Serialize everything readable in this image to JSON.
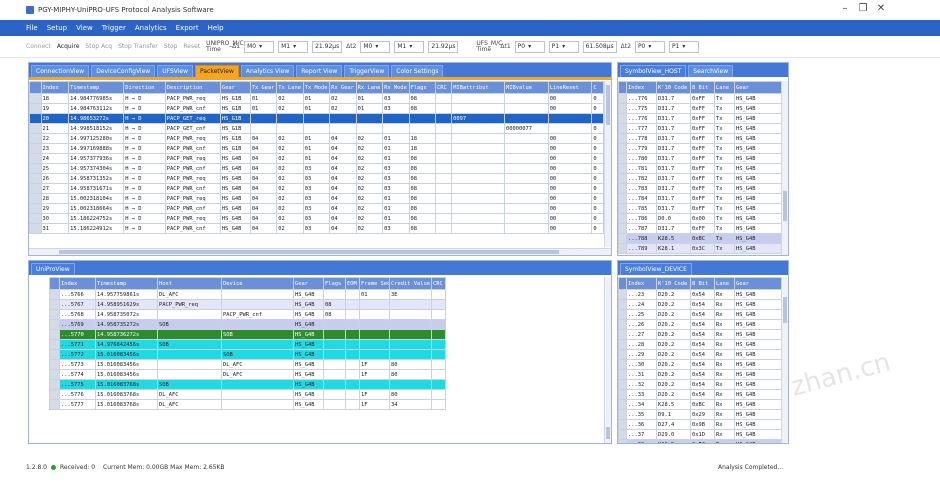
{
  "window": {
    "title": "PGY-MIPHY-UniPRO-UFS Protocol Analysis Software",
    "controls": [
      "–",
      "❐",
      "✕"
    ]
  },
  "menu": [
    "File",
    "Setup",
    "View",
    "Trigger",
    "Analytics",
    "Export",
    "Help"
  ],
  "toolbar": {
    "buttons": [
      "Connect",
      "Acquire",
      "Stop Acq",
      "Stop Transfer",
      "Stop",
      "Reset"
    ],
    "left_group": {
      "label": "UNIPRO_M/C Time",
      "delta": "Δ1",
      "m1": "M0",
      "m2": "M1",
      "time": "21.92μs",
      "delta2": "Δt2",
      "m3": "M0",
      "m4": "M1",
      "time2": "21.92μs"
    },
    "right_group": {
      "label": "UFS_M/C Time",
      "delta": "Δt1",
      "m1": "P0",
      "m2": "P1",
      "time": "61.508μs",
      "delta2": "Δt2",
      "m3": "P0",
      "m4": "P1"
    }
  },
  "top_tabs": [
    "ConnectionView",
    "DeviceConfigView",
    "UFSView",
    "PacketView",
    "Analytics View",
    "Report View",
    "TriggerView",
    "Color Settings"
  ],
  "packet_table": {
    "headers": [
      "Index",
      "Timestamp",
      "Direction",
      "Description",
      "Gear",
      "Tx Gear",
      "Tx Lane",
      "Tx Mode",
      "Rx Gear",
      "Rx Lane",
      "Rx Mode",
      "Flags",
      "CRC",
      "MIBattribut",
      "MIBvalue",
      "LineReset",
      "C"
    ],
    "rows": [
      [
        "18",
        "14.984776985s",
        "H → D",
        "PACP_PWR_req",
        "HS_G1B",
        "01",
        "02",
        "01",
        "02",
        "01",
        "03",
        "08",
        "",
        "",
        "",
        "00",
        "0"
      ],
      [
        "19",
        "14.984763112s",
        "H → D",
        "PACP_PWR_cnf",
        "HS_G1B",
        "01",
        "02",
        "01",
        "02",
        "01",
        "03",
        "08",
        "",
        "",
        "",
        "00",
        "0"
      ],
      [
        "20",
        "14.98653272s",
        "H → D",
        "PACP_GET_req",
        "HS_G1B",
        "",
        "",
        "",
        "",
        "",
        "",
        "",
        "",
        "0097",
        "",
        "",
        ""
      ],
      [
        "21",
        "14.998518152s",
        "H → D",
        "PACP_GET_cnf",
        "HS_G1B",
        "",
        "",
        "",
        "",
        "",
        "",
        "",
        "",
        "",
        "00000077",
        "",
        "0"
      ],
      [
        "22",
        "14.997125280s",
        "H → D",
        "PACP_PWR_req",
        "HS_G1B",
        "04",
        "02",
        "01",
        "04",
        "02",
        "01",
        "18",
        "",
        "",
        "",
        "00",
        "0"
      ],
      [
        "23",
        "14.997169888s",
        "H → D",
        "PACP_PWR_cnf",
        "HS_G1B",
        "04",
        "02",
        "01",
        "04",
        "02",
        "01",
        "18",
        "",
        "",
        "",
        "00",
        "0"
      ],
      [
        "24",
        "14.957377936s",
        "H → D",
        "PACP_PWR_req",
        "HS_G4B",
        "04",
        "02",
        "01",
        "04",
        "02",
        "01",
        "08",
        "",
        "",
        "",
        "00",
        "0"
      ],
      [
        "25",
        "14.957374304s",
        "H → D",
        "PACP_PWR_cnf",
        "HS_G4B",
        "04",
        "02",
        "03",
        "04",
        "02",
        "03",
        "08",
        "",
        "",
        "",
        "00",
        "0"
      ],
      [
        "26",
        "14.958731352s",
        "H → D",
        "PACP_PWR_req",
        "HS_G4B",
        "04",
        "02",
        "03",
        "04",
        "02",
        "03",
        "08",
        "",
        "",
        "",
        "00",
        "0"
      ],
      [
        "27",
        "14.958731671s",
        "H → D",
        "PACP_PWR_cnf",
        "HS_G4B",
        "04",
        "02",
        "03",
        "04",
        "02",
        "03",
        "08",
        "",
        "",
        "",
        "00",
        "0"
      ],
      [
        "28",
        "15.002318104s",
        "H → D",
        "PACP_PWR_req",
        "HS_G4B",
        "04",
        "02",
        "03",
        "04",
        "02",
        "01",
        "08",
        "",
        "",
        "",
        "00",
        "0"
      ],
      [
        "29",
        "15.002318664s",
        "H → D",
        "PACP_PWR_cnf",
        "HS_G4B",
        "04",
        "02",
        "03",
        "04",
        "02",
        "01",
        "08",
        "",
        "",
        "",
        "00",
        "0"
      ],
      [
        "30",
        "15.186224752s",
        "H → D",
        "PACP_PWR_req",
        "HS_G4B",
        "04",
        "02",
        "03",
        "04",
        "02",
        "01",
        "08",
        "",
        "",
        "",
        "00",
        "0"
      ],
      [
        "31",
        "15.186224912s",
        "H → D",
        "PACP_PWR_cnf",
        "HS_G4B",
        "04",
        "02",
        "03",
        "04",
        "02",
        "03",
        "08",
        "",
        "",
        "",
        "00",
        "0"
      ]
    ]
  },
  "symbol_host": {
    "tabs": [
      "SymbolView_HOST",
      "SearchView"
    ],
    "headers": [
      "Index",
      "K'10 Code",
      "8 Bit",
      "Lane",
      "Gear"
    ],
    "rows": [
      [
        "...776",
        "D31.7",
        "0xFF",
        "Tx",
        "HS_G4B"
      ],
      [
        "...775",
        "D31.7",
        "0xFF",
        "Tx",
        "HS_G4B"
      ],
      [
        "...776",
        "D31.7",
        "0xFF",
        "Tx",
        "HS_G4B"
      ],
      [
        "...777",
        "D31.7",
        "0xFF",
        "Tx",
        "HS_G4B"
      ],
      [
        "...778",
        "D31.7",
        "0xFF",
        "Tx",
        "HS_G4B"
      ],
      [
        "...779",
        "D31.7",
        "0xFF",
        "Tx",
        "HS_G4B"
      ],
      [
        "...780",
        "D31.7",
        "0xFF",
        "Tx",
        "HS_G4B"
      ],
      [
        "...781",
        "D31.7",
        "0xFF",
        "Tx",
        "HS_G4B"
      ],
      [
        "...782",
        "D31.7",
        "0xFF",
        "Tx",
        "HS_G4B"
      ],
      [
        "...783",
        "D31.7",
        "0xFF",
        "Tx",
        "HS_G4B"
      ],
      [
        "...784",
        "D31.7",
        "0xFF",
        "Tx",
        "HS_G4B"
      ],
      [
        "...785",
        "D31.7",
        "0xFF",
        "Tx",
        "HS_G4B"
      ],
      [
        "...786",
        "D0.0",
        "0x00",
        "Tx",
        "HS_G4B"
      ],
      [
        "...787",
        "D31.7",
        "0xFF",
        "Tx",
        "HS_G4B"
      ],
      [
        "...788",
        "K28.5",
        "0xBC",
        "Tx",
        "HS_G4B"
      ],
      [
        "...789",
        "K28.1",
        "0x3C",
        "Tx",
        "HS_G4B"
      ]
    ]
  },
  "unipro": {
    "tab": "UniProView",
    "headers": [
      "Index",
      "Timestamp",
      "Host",
      "Device",
      "Gear",
      "Flags",
      "EOM",
      "Frame Seq",
      "Credit Value",
      "CRC"
    ],
    "rows": [
      [
        "...5766",
        "14.957759861s",
        "DL_AFC",
        "",
        "HS_G4B",
        "",
        "",
        "01",
        "3E",
        ""
      ],
      [
        "...5767",
        "14.958951629s",
        "PACP_PWR_req",
        "",
        "HS_G4B",
        "08",
        "",
        "",
        "",
        ""
      ],
      [
        "...5768",
        "14.958735072s",
        "",
        "PACP_PWR_cnf",
        "HS_G4B",
        "08",
        "",
        "",
        "",
        ""
      ],
      [
        "...5769",
        "14.958735272s",
        "SOB",
        "",
        "HS_G4B",
        "",
        "",
        "",
        "",
        ""
      ],
      [
        "...5770",
        "14.958736272s",
        "",
        "SOB",
        "HS_G4B",
        "",
        "",
        "",
        "",
        ""
      ],
      [
        "...5771",
        "14.976842456s",
        "SOB",
        "",
        "HS_G4B",
        "",
        "",
        "",
        "",
        ""
      ],
      [
        "...5772",
        "15.016083456s",
        "",
        "SOB",
        "HS_G4B",
        "",
        "",
        "",
        "",
        ""
      ],
      [
        "...5773",
        "15.016083456s",
        "",
        "DL_AFC",
        "HS_G4B",
        "",
        "",
        "1F",
        "80",
        ""
      ],
      [
        "...5774",
        "15.016083456s",
        "",
        "DL_AFC",
        "HS_G4B",
        "",
        "",
        "1F",
        "80",
        ""
      ],
      [
        "...5775",
        "15.016083768s",
        "SOB",
        "",
        "HS_G4B",
        "",
        "",
        "",
        "",
        ""
      ],
      [
        "...5776",
        "15.016083768s",
        "DL_AFC",
        "",
        "HS_G4B",
        "",
        "",
        "1F",
        "80",
        ""
      ],
      [
        "...5777",
        "15.016083768s",
        "DL_AFC",
        "",
        "HS_G4B",
        "",
        "",
        "1F",
        "34",
        ""
      ]
    ]
  },
  "symbol_device": {
    "tab": "SymbolView_DEVICE",
    "headers": [
      "Index",
      "K'10 Code",
      "8 Bit",
      "Lane",
      "Gear"
    ],
    "rows": [
      [
        "...23",
        "D20.2",
        "0x54",
        "Rx",
        "HS_G4B"
      ],
      [
        "...24",
        "D20.2",
        "0x54",
        "Rx",
        "HS_G4B"
      ],
      [
        "...25",
        "D20.2",
        "0x54",
        "Rx",
        "HS_G4B"
      ],
      [
        "...26",
        "D20.2",
        "0x54",
        "Rx",
        "HS_G4B"
      ],
      [
        "...27",
        "D20.2",
        "0x54",
        "Rx",
        "HS_G4B"
      ],
      [
        "...28",
        "D20.2",
        "0x54",
        "Rx",
        "HS_G4B"
      ],
      [
        "...29",
        "D20.2",
        "0x54",
        "Rx",
        "HS_G4B"
      ],
      [
        "...30",
        "D20.2",
        "0x54",
        "Rx",
        "HS_G4B"
      ],
      [
        "...31",
        "D20.2",
        "0x54",
        "Rx",
        "HS_G4B"
      ],
      [
        "...32",
        "D20.2",
        "0x54",
        "Rx",
        "HS_G4B"
      ],
      [
        "...33",
        "D20.2",
        "0x54",
        "Rx",
        "HS_G4B"
      ],
      [
        "...34",
        "K28.5",
        "0xBC",
        "Rx",
        "HS_G4B"
      ],
      [
        "...35",
        "D9.1",
        "0x29",
        "Rx",
        "HS_G4B"
      ],
      [
        "...36",
        "D27.4",
        "0x9B",
        "Rx",
        "HS_G4B"
      ],
      [
        "...37",
        "D29.0",
        "0x1D",
        "Rx",
        "HS_G4B"
      ],
      [
        "...38",
        "K28.5",
        "0xBC",
        "Rx",
        "HS_G4B"
      ]
    ]
  },
  "status": {
    "version": "1.2.8.0",
    "received": "Received: 0",
    "memory": "Current Mem: 0.00GB  Max Mem: 2.65KB",
    "analysis": "Analysis Completed..."
  },
  "watermark": "zhan.cn"
}
